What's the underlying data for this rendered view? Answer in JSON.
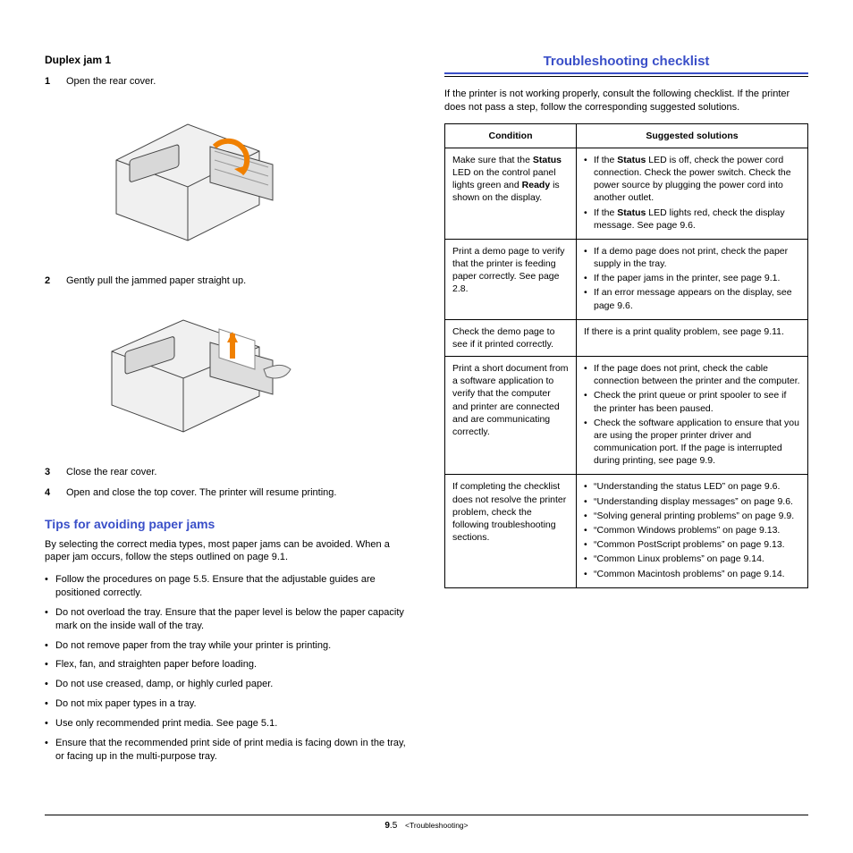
{
  "left": {
    "heading": "Duplex jam 1",
    "steps": [
      {
        "n": "1",
        "t": "Open the rear cover."
      },
      {
        "n": "2",
        "t": "Gently pull the jammed paper straight up."
      },
      {
        "n": "3",
        "t": "Close the rear cover."
      },
      {
        "n": "4",
        "t": "Open and close the top cover. The printer will resume printing."
      }
    ],
    "tips_heading": "Tips for avoiding paper jams",
    "tips_intro": "By selecting the correct media types, most paper jams can be avoided. When a paper jam occurs, follow the steps outlined on page 9.1.",
    "tips": [
      "Follow the procedures on page 5.5. Ensure that the adjustable guides are positioned correctly.",
      "Do not overload the tray. Ensure that the paper level is below the paper capacity mark on the inside wall of the tray.",
      "Do not remove paper from the tray while your printer is printing.",
      "Flex, fan, and straighten paper before loading.",
      "Do not use creased, damp, or highly curled paper.",
      "Do not mix paper types in a tray.",
      "Use only recommended print media. See page 5.1.",
      "Ensure that the recommended print side of print media is facing down in the tray, or facing up in the multi-purpose tray."
    ]
  },
  "right": {
    "heading": "Troubleshooting checklist",
    "intro": "If the printer is not working properly, consult the following checklist. If the printer does not pass a step, follow the corresponding suggested solutions.",
    "th_cond": "Condition",
    "th_sol": "Suggested solutions",
    "rows": [
      {
        "cond_pre": "Make sure that the ",
        "cond_b1": "Status",
        "cond_mid": " LED on the control panel lights green and ",
        "cond_b2": "Ready",
        "cond_post": " is shown on the display.",
        "sol_b1_pre": "If the ",
        "sol_b1_b": "Status",
        "sol_b1_post": " LED is off, check the power cord connection. Check the power switch. Check the power source by plugging the power cord into another outlet.",
        "sol_b2_pre": "If the ",
        "sol_b2_b": "Status",
        "sol_b2_post": " LED lights red, check the display message. See page 9.6."
      },
      {
        "cond": "Print a demo page to verify that the printer is feeding paper correctly. See page 2.8.",
        "sols": [
          "If a demo page does not print, check the paper supply in the tray.",
          "If the paper jams in the printer, see page 9.1.",
          "If an error message appears on the display, see page 9.6."
        ]
      },
      {
        "cond": "Check the demo page to see if it printed correctly.",
        "sol_plain": "If there is a print quality problem, see page 9.11."
      },
      {
        "cond": "Print a short document from a software application to verify that the computer and printer are connected and are communicating correctly.",
        "sols": [
          "If the page does not print, check the cable connection between the printer and the computer.",
          "Check the print queue or print spooler to see if the printer has been paused.",
          "Check the software application to ensure that you are using the proper printer driver and communication port. If the page is interrupted during printing, see page 9.9."
        ]
      },
      {
        "cond": "If completing the checklist does not resolve the printer problem, check the following troubleshooting sections.",
        "sols": [
          "“Understanding the status LED” on page 9.6.",
          "“Understanding display messages” on page 9.6.",
          "“Solving general printing problems” on page 9.9.",
          "“Common Windows problems” on page 9.13.",
          "“Common PostScript problems” on page 9.13.",
          "“Common Linux problems” on page 9.14.",
          "“Common Macintosh problems” on page 9.14."
        ]
      }
    ]
  },
  "footer": {
    "page_major": "9",
    "page_minor": ".5",
    "section": "<Troubleshooting>"
  }
}
